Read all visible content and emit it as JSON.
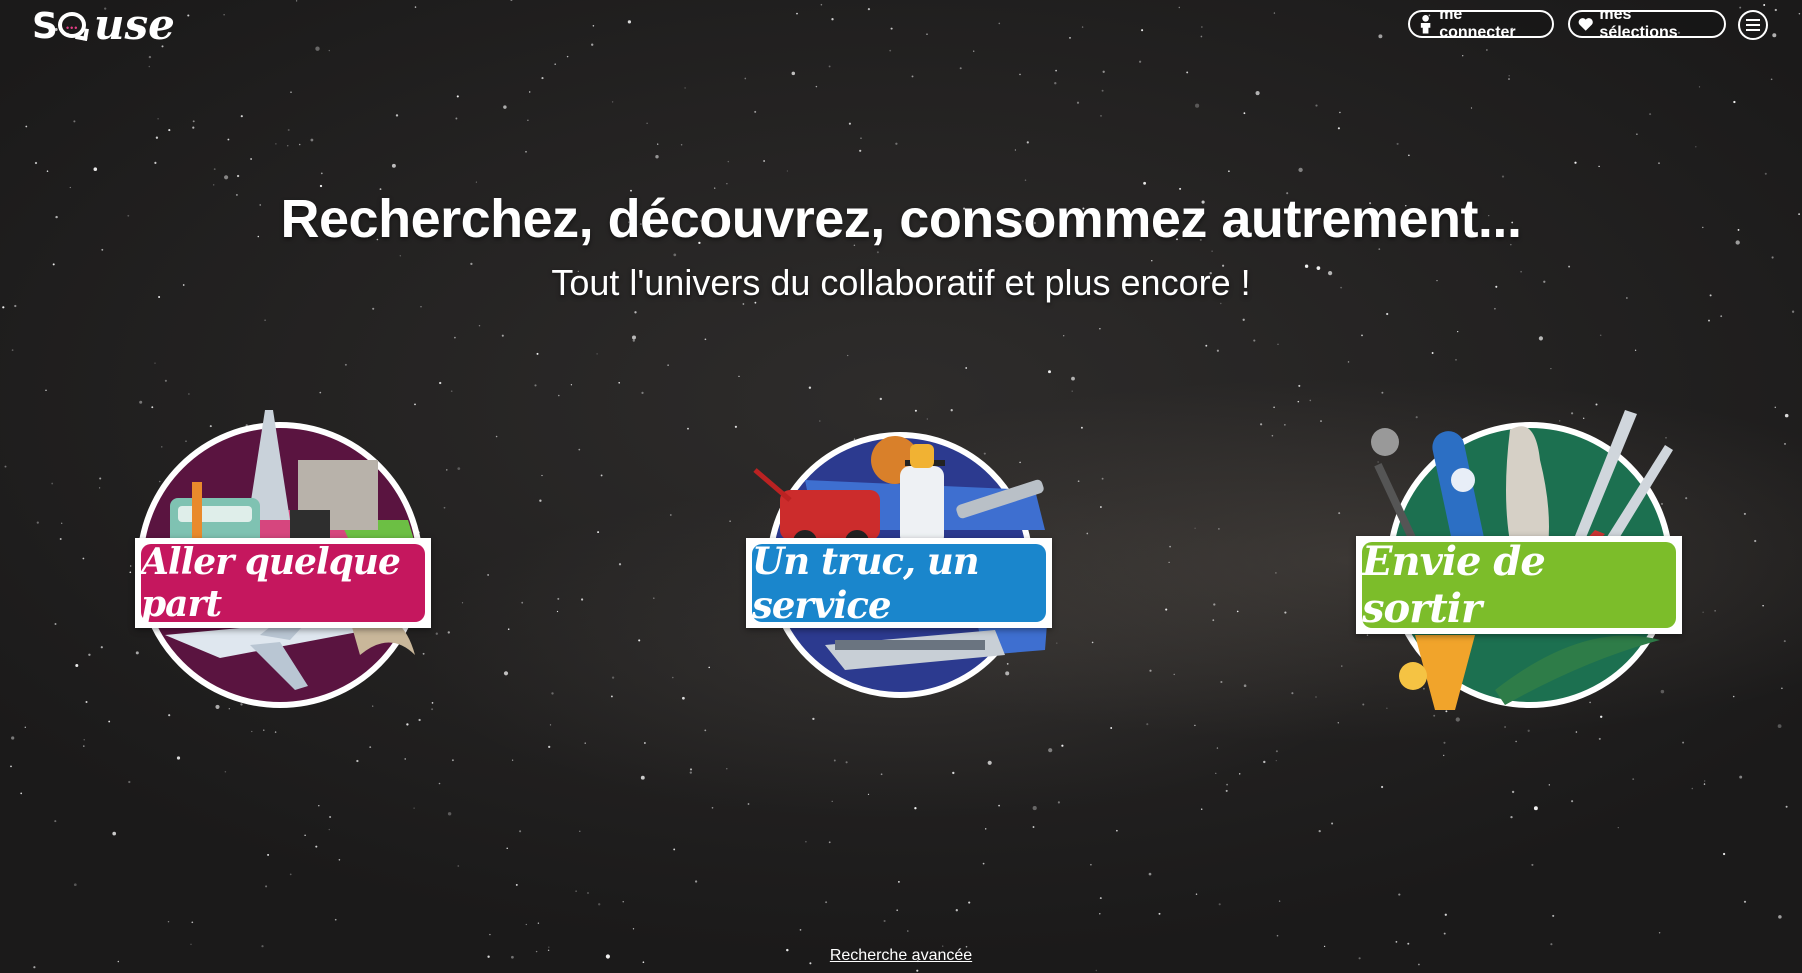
{
  "header": {
    "logo": {
      "text_s": "S",
      "text_use": "use",
      "dots": "•••"
    },
    "login_label": "me connecter",
    "selections_label": "mes sélections",
    "icons": {
      "login": "person-icon",
      "selections": "heart-icon",
      "menu": "hamburger-menu-icon"
    }
  },
  "hero": {
    "title": "Recherchez, découvrez, consommez autrement...",
    "subtitle": "Tout l'univers du collaboratif et plus encore !"
  },
  "categories": [
    {
      "label": "Aller quelque part",
      "color": "#c5175e"
    },
    {
      "label": "Un truc, un service",
      "color": "#1a86cc"
    },
    {
      "label": "Envie de sortir",
      "color": "#7cbd2a"
    }
  ],
  "footer": {
    "advanced_search_label": "Recherche avancée"
  }
}
